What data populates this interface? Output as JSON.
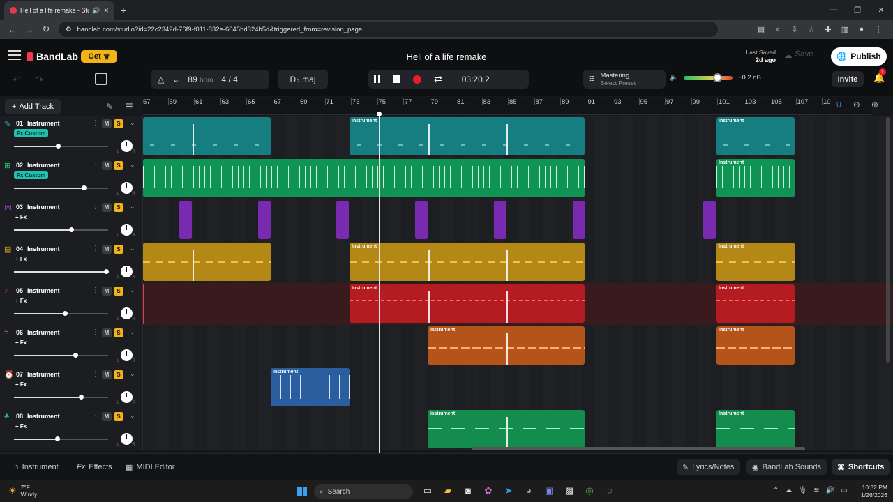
{
  "browser": {
    "tab_title": "Hell of a life remake - Studi",
    "new_tab_label": "+",
    "url": "bandlab.com/studio?id=22c2342d-76f9-f011-832e-6045bd324b5d&triggered_from=revision_page"
  },
  "app": {
    "brand": "BandLab",
    "get_label": "Get",
    "project_title": "Hell of a life remake",
    "last_saved_label": "Last Saved",
    "last_saved_value": "2d ago",
    "save_label": "Save",
    "publish_label": "Publish",
    "invite_label": "Invite",
    "notification_count": "1"
  },
  "toolbar": {
    "bpm_value": "89",
    "bpm_unit": "bpm",
    "time_signature": "4 / 4",
    "key": "D♭ maj",
    "time": "03:20.2",
    "mastering_label": "Mastering",
    "mastering_preset": "Select Preset",
    "volume_db": "+0.2 dB",
    "accent_color": "#f2b316",
    "record_color": "#e61e2a"
  },
  "tracks_header": {
    "add_track_label": "Add Track"
  },
  "ruler": {
    "bars": [
      "57",
      "59",
      "61",
      "63",
      "65",
      "67",
      "69",
      "71",
      "73",
      "75",
      "77",
      "79",
      "81",
      "83",
      "85",
      "87",
      "89",
      "91",
      "93",
      "95",
      "97",
      "99",
      "101",
      "103",
      "105",
      "107",
      "10"
    ]
  },
  "tracks": [
    {
      "num": "01",
      "name": "Instrument",
      "fx": "Fx Custom",
      "color": "#1ec2b0",
      "icon": "pencil-icon",
      "volume": 0.47,
      "clips": [
        "",
        "Instrument",
        "Instrument"
      ]
    },
    {
      "num": "02",
      "name": "Instrument",
      "fx": "Fx Custom",
      "color": "#25c26a",
      "icon": "grid-icon",
      "volume": 0.74,
      "clips": [
        "",
        "Instrument"
      ]
    },
    {
      "num": "03",
      "name": "Instrument",
      "fx": "+ Fx",
      "color": "#9b40d0",
      "icon": "ribbon-icon",
      "volume": 0.61,
      "clips": []
    },
    {
      "num": "04",
      "name": "Instrument",
      "fx": "+ Fx",
      "color": "#f2b316",
      "icon": "keyboard-icon",
      "volume": 0.98,
      "clips": [
        "",
        "Instrument",
        "Instrument"
      ]
    },
    {
      "num": "05",
      "name": "Instrument",
      "fx": "+ Fx",
      "color": "#e8384f",
      "icon": "guitar-icon",
      "volume": 0.54,
      "clips": [
        "Instrument",
        "Instrument"
      ]
    },
    {
      "num": "06",
      "name": "Instrument",
      "fx": "+ Fx",
      "color": "#f07a2e",
      "icon": "wave-icon",
      "volume": 0.65,
      "clips": [
        "Instrument",
        "Instrument"
      ]
    },
    {
      "num": "07",
      "name": "Instrument",
      "fx": "+ Fx",
      "color": "#3a7bd5",
      "icon": "alarm-icon",
      "volume": 0.71,
      "clips": [
        "Instrument"
      ]
    },
    {
      "num": "08",
      "name": "Instrument",
      "fx": "+ Fx",
      "color": "#25c26a",
      "icon": "leaf-icon",
      "volume": 0.46,
      "clips": [
        "Instrument",
        "Instrument"
      ]
    }
  ],
  "track_controls": {
    "mute": "M",
    "solo": "S",
    "left": "L",
    "right": "R"
  },
  "bottom": {
    "instrument_label": "Instrument",
    "effects_label": "Effects",
    "midi_editor_label": "MIDI Editor",
    "lyrics_label": "Lyrics/Notes",
    "sounds_label": "BandLab Sounds",
    "shortcuts_label": "Shortcuts"
  },
  "taskbar": {
    "temp": "7°F",
    "weather": "Windy",
    "search_placeholder": "Search",
    "time": "10:32 PM",
    "date": "1/26/2026"
  }
}
